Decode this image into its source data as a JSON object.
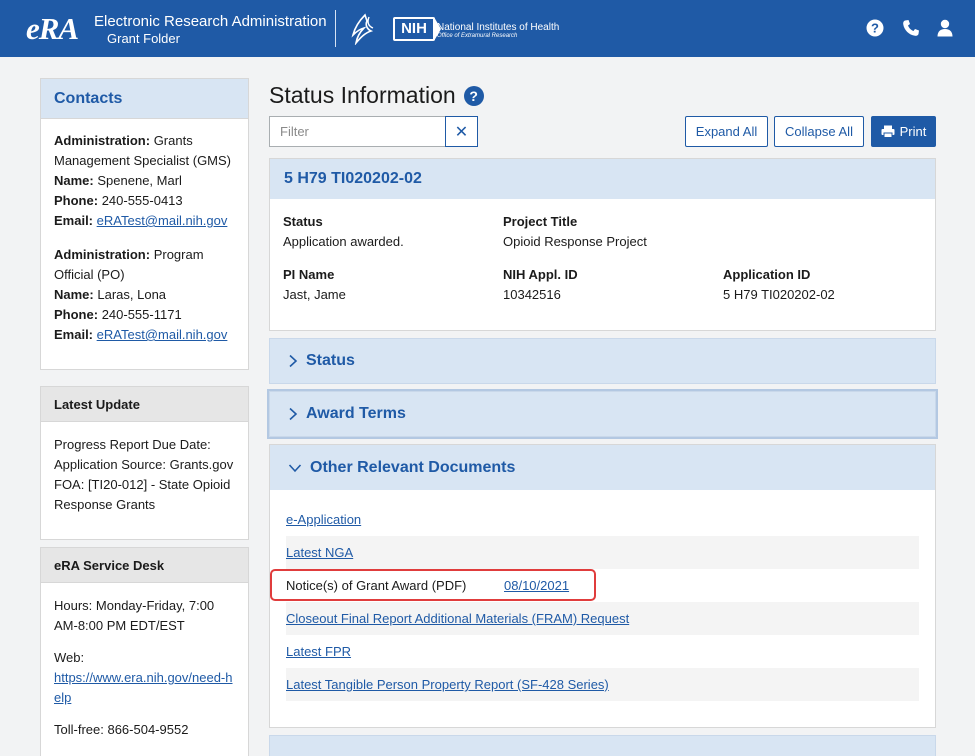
{
  "header": {
    "logo_text": "eRA",
    "app_title": "Electronic Research Administration",
    "app_subtitle": "Grant Folder",
    "nih_mark": "NIH",
    "nih_name": "National Institutes of Health",
    "nih_office": "Office of Extramural Research",
    "icons": [
      "help-icon",
      "phone-icon",
      "user-icon"
    ]
  },
  "sidebar": {
    "contacts_title": "Contacts",
    "contacts": [
      {
        "admin_label": "Administration:",
        "admin_value": "Grants Management Specialist (GMS)",
        "name_label": "Name:",
        "name_value": "Spenene, Marl",
        "phone_label": "Phone:",
        "phone_value": "240-555-0413",
        "email_label": "Email:",
        "email_value": "eRATest@mail.nih.gov"
      },
      {
        "admin_label": "Administration:",
        "admin_value": "Program Official (PO)",
        "name_label": "Name:",
        "name_value": "Laras, Lona",
        "phone_label": "Phone:",
        "phone_value": "240-555-1171",
        "email_label": "Email:",
        "email_value": "eRATest@mail.nih.gov"
      }
    ],
    "latest_update_title": "Latest Update",
    "latest_update_lines": [
      "Progress Report Due Date:",
      "Application Source: Grants.gov",
      "FOA: [TI20-012] -  State Opioid Response Grants"
    ],
    "service_desk_title": "eRA Service Desk",
    "service_desk_hours": "Hours: Monday-Friday, 7:00 AM-8:00 PM EDT/EST",
    "service_desk_web_label": "Web:",
    "service_desk_web_link": "https://www.era.nih.gov/need-help",
    "service_desk_tollfree": "Toll-free: 866-504-9552"
  },
  "main": {
    "page_title": "Status Information",
    "help_glyph": "?",
    "filter_placeholder": "Filter",
    "clear_glyph": "✕",
    "expand_all": "Expand All",
    "collapse_all": "Collapse All",
    "print": "Print",
    "grant_number": "5 H79 TI020202-02",
    "summary": {
      "status_label": "Status",
      "status_value": "Application awarded.",
      "project_title_label": "Project Title",
      "project_title_value": "Opioid Response Project",
      "pi_name_label": "PI Name",
      "pi_name_value": "Jast, Jame",
      "nih_appl_id_label": "NIH Appl. ID",
      "nih_appl_id_value": "10342516",
      "application_id_label": "Application ID",
      "application_id_value": "5 H79 TI020202-02"
    },
    "sections": [
      {
        "label": "Status",
        "expanded": false
      },
      {
        "label": "Award Terms",
        "expanded": false
      },
      {
        "label": "Other Relevant Documents",
        "expanded": true
      }
    ],
    "documents": [
      {
        "label": "e-Application",
        "link": true
      },
      {
        "label": "Latest NGA",
        "link": true
      },
      {
        "label": "Notice(s) of Grant Award (PDF)",
        "link": false,
        "date": "08/10/2021"
      },
      {
        "label": "Closeout Final Report Additional Materials (FRAM) Request",
        "link": true
      },
      {
        "label": "Latest FPR",
        "link": true
      },
      {
        "label": "Latest Tangible Person Property Report (SF-428 Series)",
        "link": true
      }
    ]
  }
}
